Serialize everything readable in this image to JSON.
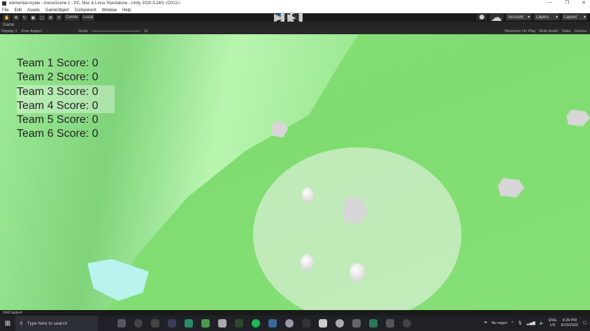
{
  "window": {
    "title": "elemental-royale - ArenaScene 1 - PC, Mac & Linux Standalone - Unity 2020.3.24f1 <DX11>",
    "minimize": "—",
    "restore": "❐",
    "close": "✕"
  },
  "menu": [
    "File",
    "Edit",
    "Assets",
    "GameObject",
    "Component",
    "Window",
    "Help"
  ],
  "toolbar": {
    "center": "Center",
    "local": "Local",
    "account": "Account",
    "layers": "Layers",
    "layout": "Layout"
  },
  "game": {
    "tab": "Game",
    "display": "Display 1",
    "aspect": "Free Aspect",
    "scale_label": "Scale",
    "scale_value": "1x",
    "maximize": "Maximize On Play",
    "mute": "Mute Audio",
    "stats": "Stats",
    "gizmos": "Gizmos"
  },
  "scores": [
    "Team 1 Score: 0",
    "Team 2 Score: 0",
    "Team 3 Score: 0",
    "Team 4 Score: 0",
    "Team 5 Score: 0",
    "Team 6 Score: 0"
  ],
  "status": "NotCapped",
  "taskbar": {
    "search_placeholder": "Type here to search",
    "weather": "Nu regen",
    "lang1": "ENG",
    "lang2": "US",
    "time": "4:28 PM",
    "date": "8/19/2022"
  }
}
